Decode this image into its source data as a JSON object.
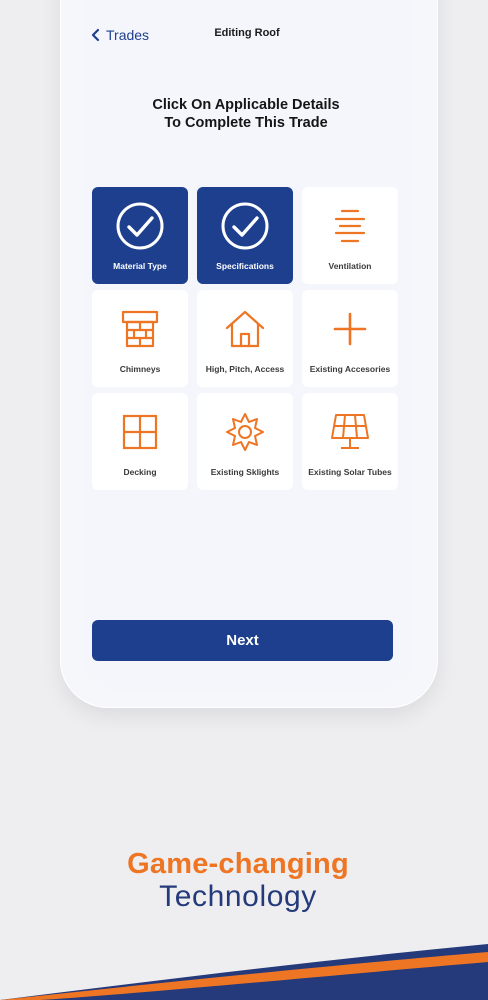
{
  "nav": {
    "back_label": "Trades",
    "title": "Editing Roof"
  },
  "heading": "Click On Applicable Details\nTo Complete This Trade",
  "tiles": [
    {
      "label": "Material Type",
      "icon": "check-circle-icon",
      "selected": true
    },
    {
      "label": "Specifications",
      "icon": "check-circle-icon",
      "selected": true
    },
    {
      "label": "Ventilation",
      "icon": "vent-lines-icon",
      "selected": false
    },
    {
      "label": "Chimneys",
      "icon": "chimney-icon",
      "selected": false
    },
    {
      "label": "High, Pitch, Access",
      "icon": "house-icon",
      "selected": false
    },
    {
      "label": "Existing Accesories",
      "icon": "plus-icon",
      "selected": false
    },
    {
      "label": "Decking",
      "icon": "grid-window-icon",
      "selected": false
    },
    {
      "label": "Existing Sklights",
      "icon": "sun-icon",
      "selected": false
    },
    {
      "label": "Existing Solar Tubes",
      "icon": "solar-panel-icon",
      "selected": false
    }
  ],
  "next_label": "Next",
  "tagline": {
    "line1": "Game-changing",
    "line2": "Technology"
  },
  "colors": {
    "primary": "#1d3f8e",
    "accent": "#ee7524",
    "tagline_blue": "#243a7a"
  }
}
